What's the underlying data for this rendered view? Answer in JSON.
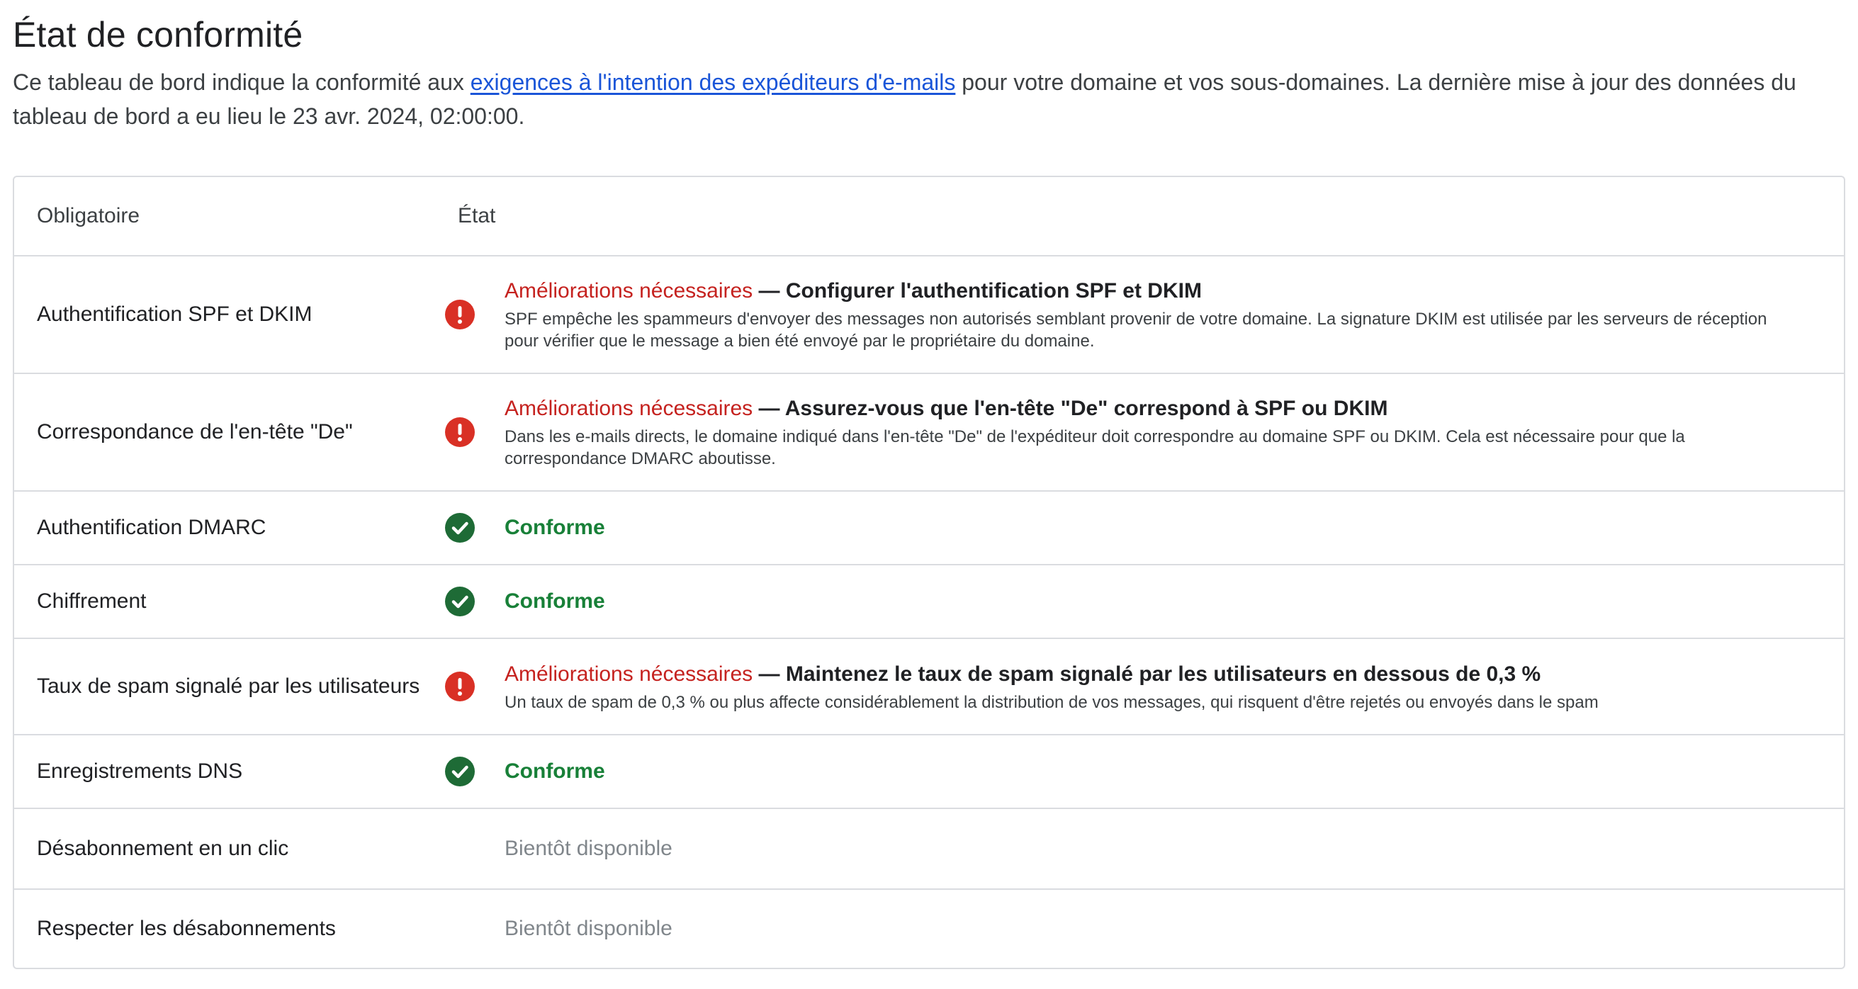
{
  "page": {
    "title": "État de conformité",
    "intro_before": "Ce tableau de bord indique la conformité aux ",
    "intro_link": "exigences à l'intention des expéditeurs d'e-mails",
    "intro_after": " pour votre domaine et vos sous-domaines. La dernière mise à jour des données du tableau de bord a eu lieu le 23 avr. 2024, 02:00:00."
  },
  "table": {
    "header": {
      "requirement": "Obligatoire",
      "status": "État"
    },
    "rows": [
      {
        "requirement": "Authentification SPF et DKIM",
        "state": "error",
        "status_label": "Améliorations nécessaires",
        "separator": " — ",
        "status_title": "Configurer l'authentification SPF et DKIM",
        "description": "SPF empêche les spammeurs d'envoyer des messages non autorisés semblant provenir de votre domaine. La signature DKIM est utilisée par les serveurs de réception pour vérifier que le message a bien été envoyé par le propriétaire du domaine.",
        "icon": "error-icon"
      },
      {
        "requirement": "Correspondance de l'en-tête \"De\"",
        "state": "error",
        "status_label": "Améliorations nécessaires",
        "separator": " — ",
        "status_title": "Assurez-vous que l'en-tête \"De\" correspond à SPF ou DKIM",
        "description": "Dans les e-mails directs, le domaine indiqué dans l'en-tête \"De\" de l'expéditeur doit correspondre au domaine SPF ou DKIM. Cela est nécessaire pour que la correspondance DMARC aboutisse.",
        "icon": "error-icon"
      },
      {
        "requirement": "Authentification DMARC",
        "state": "ok",
        "status_label": "Conforme",
        "icon": "check-circle-icon"
      },
      {
        "requirement": "Chiffrement",
        "state": "ok",
        "status_label": "Conforme",
        "icon": "check-circle-icon"
      },
      {
        "requirement": "Taux de spam signalé par les utilisateurs",
        "state": "error",
        "status_label": "Améliorations nécessaires",
        "separator": " — ",
        "status_title": "Maintenez le taux de spam signalé par les utilisateurs en dessous de 0,3 %",
        "description": "Un taux de spam de 0,3 % ou plus affecte considérablement la distribution de vos messages, qui risquent d'être rejetés ou envoyés dans le spam",
        "icon": "error-icon"
      },
      {
        "requirement": "Enregistrements DNS",
        "state": "ok",
        "status_label": "Conforme",
        "icon": "check-circle-icon"
      },
      {
        "requirement": "Désabonnement en un clic",
        "state": "soon",
        "status_label": "Bientôt disponible"
      },
      {
        "requirement": "Respecter les désabonnements",
        "state": "soon",
        "status_label": "Bientôt disponible"
      }
    ]
  },
  "colors": {
    "error": "#d93025",
    "ok": "#1e6b36",
    "ok_text": "#188038",
    "link": "#1a55d8",
    "muted": "#80868b"
  }
}
